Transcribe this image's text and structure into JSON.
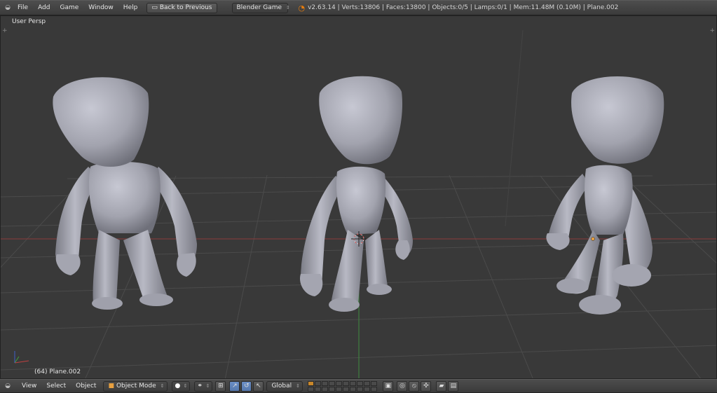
{
  "header": {
    "menus": [
      "File",
      "Add",
      "Game",
      "Window",
      "Help"
    ],
    "back_button": "Back to Previous",
    "engine": "Blender Game",
    "stats": "v2.63.14 | Verts:13806 | Faces:13800 | Objects:0/5 | Lamps:0/1 | Mem:11.48M (0.10M) | Plane.002"
  },
  "viewport": {
    "view_name": "User Persp",
    "object_info": "(64) Plane.002"
  },
  "footer": {
    "menus": [
      "View",
      "Select",
      "Object"
    ],
    "mode": "Object Mode",
    "orientation": "Global"
  },
  "colors": {
    "background": "#393939",
    "grid": "#4a4a4a",
    "x_axis": "#8a3a3a",
    "y_axis": "#3f8a3f",
    "mesh": "#a9aab5",
    "accent": "#e87d0d"
  }
}
